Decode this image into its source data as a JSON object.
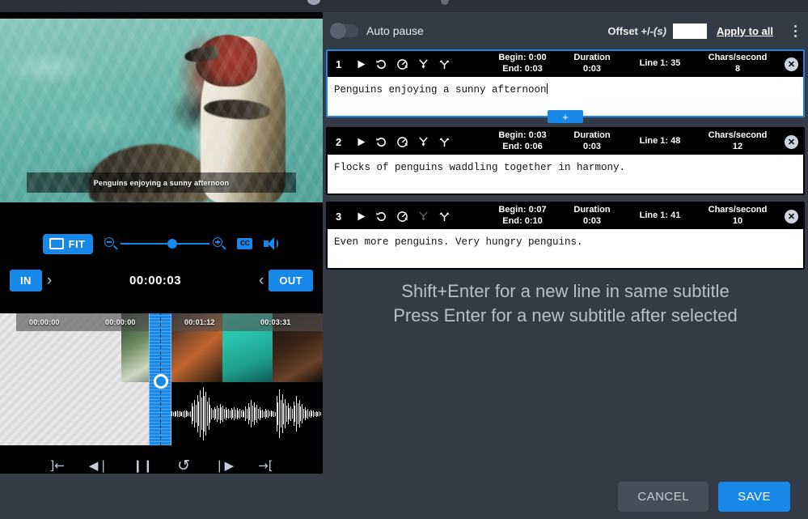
{
  "player": {
    "subtitle_overlay": "Penguins enjoying a sunny afternoon",
    "fit_label": "FIT",
    "cc_label": "CC",
    "in_label": "IN",
    "out_label": "OUT",
    "timecode": "00:00:03",
    "next_chevron": "›",
    "prev_chevron": "‹",
    "timeline_ticks": [
      "00:00:00",
      "00:00:00",
      "00:01:12",
      "00:03:31"
    ],
    "transport": [
      {
        "name": "go-to-in-point",
        "glyph": "]←"
      },
      {
        "name": "step-backward",
        "glyph": "◀❘"
      },
      {
        "name": "pause",
        "glyph": "❙❙"
      },
      {
        "name": "loop",
        "glyph": "↺"
      },
      {
        "name": "step-forward",
        "glyph": "❘▶"
      },
      {
        "name": "go-to-out-point",
        "glyph": "→["
      }
    ]
  },
  "toolbar": {
    "auto_pause_label": "Auto pause",
    "auto_pause_on": false,
    "offset_label": "Offset +/-",
    "offset_label_unit": "(s)",
    "offset_value": "",
    "offset_placeholder": "",
    "apply_to_all_label": "Apply to all"
  },
  "subtitles": [
    {
      "number": "1",
      "begin": "Begin: 0:00",
      "end": "End: 0:03",
      "duration_label": "Duration",
      "duration_value": "0:03",
      "line_label": "Line 1:",
      "line_value": "35",
      "cps_label": "Chars/second",
      "cps_value": "8",
      "text": "Penguins enjoying a sunny afternoon",
      "selected": true,
      "merge_disabled": false,
      "add_label": "+"
    },
    {
      "number": "2",
      "begin": "Begin: 0:03",
      "end": "End: 0:06",
      "duration_label": "Duration",
      "duration_value": "0:03",
      "line_label": "Line 1:",
      "line_value": "48",
      "cps_label": "Chars/second",
      "cps_value": "12",
      "text": "Flocks of penguins waddling together in harmony.",
      "selected": false,
      "merge_disabled": false,
      "add_label": "+"
    },
    {
      "number": "3",
      "begin": "Begin: 0:07",
      "end": "End: 0:10",
      "duration_label": "Duration",
      "duration_value": "0:03",
      "line_label": "Line 1:",
      "line_value": "41",
      "cps_label": "Chars/second",
      "cps_value": "10",
      "text": "Even more penguins. Very hungry penguins.",
      "selected": false,
      "merge_disabled": true,
      "add_label": "+"
    }
  ],
  "hint": {
    "line1": "Shift+Enter for a new line in same subtitle",
    "line2": "Press Enter for a new subtitle after selected"
  },
  "footer": {
    "cancel_label": "CANCEL",
    "save_label": "SAVE"
  },
  "colors": {
    "accent": "#1787e8",
    "panel": "#343a46",
    "panel_dark": "#2b303b",
    "card": "#000000"
  }
}
